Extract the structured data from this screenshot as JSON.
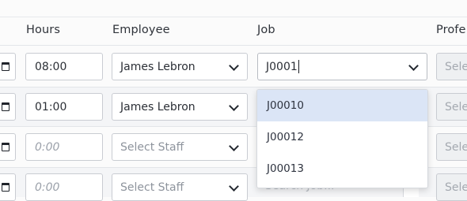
{
  "columns": {
    "hours": "Hours",
    "employee": "Employee",
    "job": "Job",
    "profession": "Profe"
  },
  "rows": [
    {
      "hours": "08:00",
      "employee": "James Lebron",
      "job": "J0001",
      "profession": "Sele"
    },
    {
      "hours": "01:00",
      "employee": "James Lebron",
      "profession": "Sele"
    },
    {
      "hours_placeholder": "0:00",
      "employee_placeholder": "Select Staff",
      "profession": "Sele"
    },
    {
      "hours_placeholder": "0:00",
      "employee_placeholder": "Select Staff",
      "profession": "Sele"
    }
  ],
  "job_dropdown": {
    "options": [
      "J00010",
      "J00012",
      "J00013"
    ],
    "highlighted_index": 0,
    "search_placeholder": "Search Job..."
  },
  "icons": [
    "calendar-icon",
    "chevron-down-icon"
  ],
  "colors": {
    "highlight": "#dbe5f6",
    "border": "#c9ccd2"
  }
}
